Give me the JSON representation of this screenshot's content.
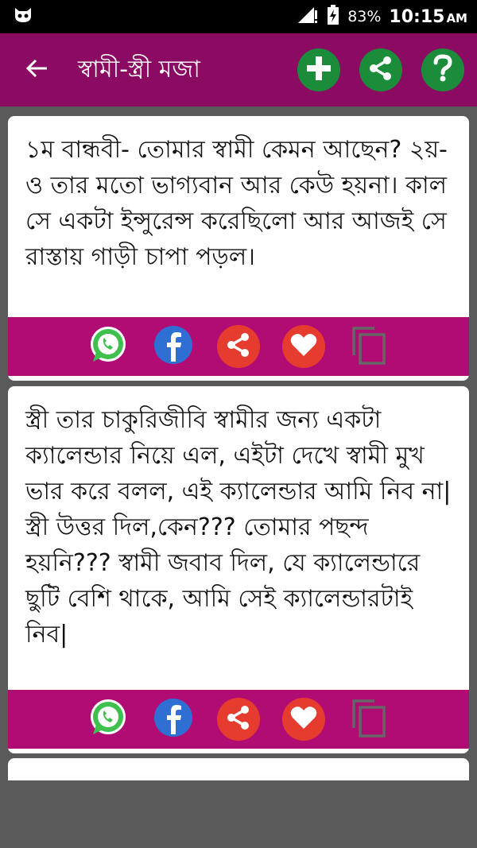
{
  "status": {
    "battery": "83%",
    "time": "10:15",
    "ampm": "AM"
  },
  "appbar": {
    "title": "স্বামী-স্ত্রী মজা"
  },
  "jokes": [
    {
      "text": "১ম বান্ধবী- তোমার স্বামী কেমন আছেন? ২য়- ও তার মতো ভাগ্যবান আর কেউ হয়না। কাল সে একটা ইন্সুরেন্স করেছিলো আর আজই সে রাস্তায় গাড়ী চাপা পড়ল।"
    },
    {
      "text": "স্ত্রী তার চাকুরিজীবি স্বামীর জন্য একটা ক্যালেন্ডার নিয়ে এল, এইটা দেখে স্বামী মুখ ভার করে বলল, এই ক্যালেন্ডার আমি নিব না| স্ত্রী উত্তর দিল,কেন??? তোমার পছন্দ হয়নি??? স্বামী জবাব দিল, যে ক্যালেন্ডারে ছুটি বেশি থাকে, আমি সেই ক্যালেন্ডারটাই নিব|"
    },
    {
      "text": ""
    }
  ],
  "icons": {
    "whatsapp": "whatsapp-icon",
    "facebook": "facebook-icon",
    "share": "share-icon",
    "favorite": "heart-icon",
    "copy": "copy-icon"
  },
  "colors": {
    "appbar": "#8b0b62",
    "card_actions": "#b10c73",
    "green": "#1b8c3a"
  }
}
